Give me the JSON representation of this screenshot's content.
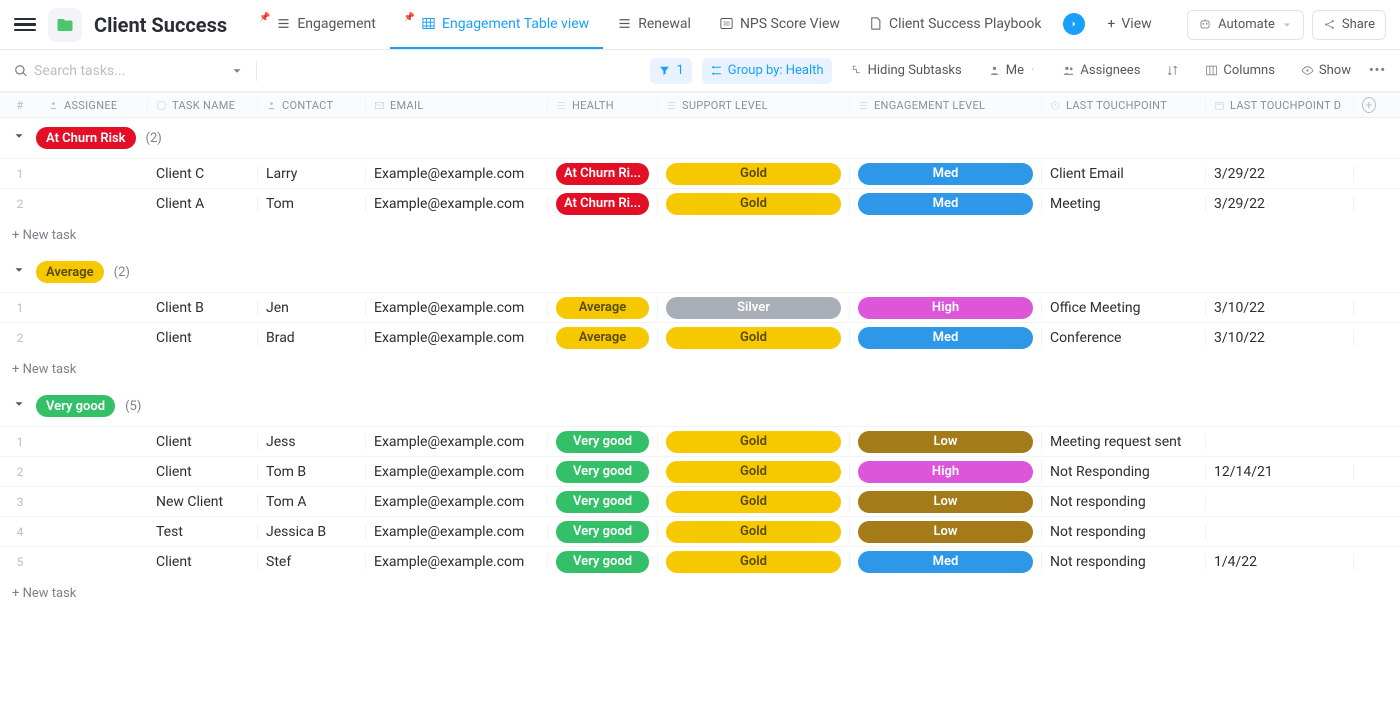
{
  "header": {
    "title": "Client Success",
    "tabs": [
      {
        "label": "Engagement"
      },
      {
        "label": "Engagement Table view"
      },
      {
        "label": "Renewal"
      },
      {
        "label": "NPS Score View"
      },
      {
        "label": "Client Success Playbook"
      }
    ],
    "view_btn": "View",
    "automate_btn": "Automate",
    "share_btn": "Share"
  },
  "toolbar": {
    "search_placeholder": "Search tasks...",
    "filter_count": "1",
    "group_by": "Group by: Health",
    "hiding": "Hiding Subtasks",
    "me": "Me",
    "assignees": "Assignees",
    "columns": "Columns",
    "show": "Show"
  },
  "columns": {
    "num": "#",
    "assignee": "ASSIGNEE",
    "task": "TASK NAME",
    "contact": "CONTACT",
    "email": "EMAIL",
    "health": "HEALTH",
    "support": "SUPPORT LEVEL",
    "engage": "ENGAGEMENT LEVEL",
    "touch": "LAST TOUCHPOINT",
    "date": "LAST TOUCHPOINT D"
  },
  "colors": {
    "red": "#e30f26",
    "yellow": "#f5c800",
    "green": "#33c069",
    "silver": "#a7aeb8",
    "blue": "#2e97e8",
    "pink": "#dd55d9",
    "brown": "#a57a18",
    "yellow_text": "#5a4a00"
  },
  "groups": [
    {
      "name": "At Churn Risk",
      "count": "(2)",
      "badge_bg": "red",
      "rows": [
        {
          "num": "1",
          "task": "Client C",
          "contact": "Larry",
          "email": "Example@example.com",
          "health": "At Churn Ri...",
          "health_bg": "red",
          "support": "Gold",
          "support_bg": "yellow",
          "engage": "Med",
          "engage_bg": "blue",
          "touch": "Client Email",
          "date": "3/29/22"
        },
        {
          "num": "2",
          "task": "Client A",
          "contact": "Tom",
          "email": "Example@example.com",
          "health": "At Churn Ri...",
          "health_bg": "red",
          "support": "Gold",
          "support_bg": "yellow",
          "engage": "Med",
          "engage_bg": "blue",
          "touch": "Meeting",
          "date": "3/29/22"
        }
      ]
    },
    {
      "name": "Average",
      "count": "(2)",
      "badge_bg": "yellow",
      "rows": [
        {
          "num": "1",
          "task": "Client B",
          "contact": "Jen",
          "email": "Example@example.com",
          "health": "Average",
          "health_bg": "yellow",
          "support": "Silver",
          "support_bg": "silver",
          "engage": "High",
          "engage_bg": "pink",
          "touch": "Office Meeting",
          "date": "3/10/22"
        },
        {
          "num": "2",
          "task": "Client",
          "contact": "Brad",
          "email": "Example@example.com",
          "health": "Average",
          "health_bg": "yellow",
          "support": "Gold",
          "support_bg": "yellow",
          "engage": "Med",
          "engage_bg": "blue",
          "touch": "Conference",
          "date": "3/10/22"
        }
      ]
    },
    {
      "name": "Very good",
      "count": "(5)",
      "badge_bg": "green",
      "rows": [
        {
          "num": "1",
          "task": "Client",
          "contact": "Jess",
          "email": "Example@example.com",
          "health": "Very good",
          "health_bg": "green",
          "support": "Gold",
          "support_bg": "yellow",
          "engage": "Low",
          "engage_bg": "brown",
          "touch": "Meeting request sent",
          "date": ""
        },
        {
          "num": "2",
          "task": "Client",
          "contact": "Tom B",
          "email": "Example@example.com",
          "health": "Very good",
          "health_bg": "green",
          "support": "Gold",
          "support_bg": "yellow",
          "engage": "High",
          "engage_bg": "pink",
          "touch": "Not Responding",
          "date": "12/14/21"
        },
        {
          "num": "3",
          "task": "New Client",
          "contact": "Tom A",
          "email": "Example@example.com",
          "health": "Very good",
          "health_bg": "green",
          "support": "Gold",
          "support_bg": "yellow",
          "engage": "Low",
          "engage_bg": "brown",
          "touch": "Not responding",
          "date": ""
        },
        {
          "num": "4",
          "task": "Test",
          "contact": "Jessica B",
          "email": "Example@example.com",
          "health": "Very good",
          "health_bg": "green",
          "support": "Gold",
          "support_bg": "yellow",
          "engage": "Low",
          "engage_bg": "brown",
          "touch": "Not responding",
          "date": ""
        },
        {
          "num": "5",
          "task": "Client",
          "contact": "Stef",
          "email": "Example@example.com",
          "health": "Very good",
          "health_bg": "green",
          "support": "Gold",
          "support_bg": "yellow",
          "engage": "Med",
          "engage_bg": "blue",
          "touch": "Not responding",
          "date": "1/4/22"
        }
      ]
    }
  ],
  "new_task": "+ New task"
}
